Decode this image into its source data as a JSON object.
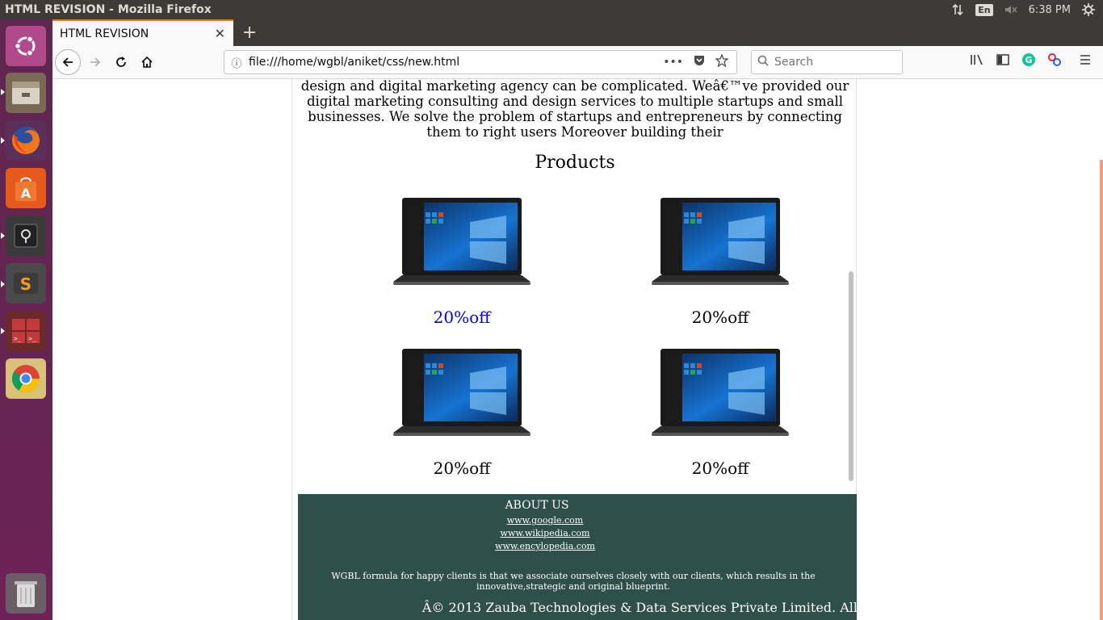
{
  "system_bar": {
    "window_title": "HTML REVISION - Mozilla Firefox",
    "keyboard_layout": "En",
    "time": "6:38 PM"
  },
  "launcher": {
    "apps": [
      "ubuntu-dash-icon",
      "files-icon",
      "firefox-icon",
      "software-center-icon",
      "vault-icon",
      "sublime-text-icon",
      "terminal-icon",
      "chrome-icon",
      "trash-icon"
    ]
  },
  "browser": {
    "tab_title": "HTML REVISION",
    "url": "file:///home/wgbl/aniket/css/new.html",
    "search_placeholder": "Search"
  },
  "page": {
    "intro_text": "is not present, the tag is not a hyperlinkFinding the right connection of strategic design and digital marketing agency can be complicated. Weâ€™ve provided our digital marketing consulting and design services to multiple startups and small businesses. We solve the problem of startups and entrepreneurs by connecting them to right users Moreover building their",
    "products_title": "Products",
    "products": [
      {
        "offer": "20%off",
        "is_link": true
      },
      {
        "offer": "20%off",
        "is_link": false
      },
      {
        "offer": "20%off",
        "is_link": false
      },
      {
        "offer": "20%off",
        "is_link": false
      }
    ],
    "footer": {
      "title": "ABOUT US",
      "links": [
        "www.google.com",
        "www.wikipedia.com",
        "www.encylopedia.com"
      ],
      "description": "WGBL formula for happy clients is that we associate ourselves closely with our clients, which results in the innovative,strategic and original blueprint.",
      "copyright": "Â© 2013 Zauba Technologies & Data Services Private Limited. All"
    }
  }
}
